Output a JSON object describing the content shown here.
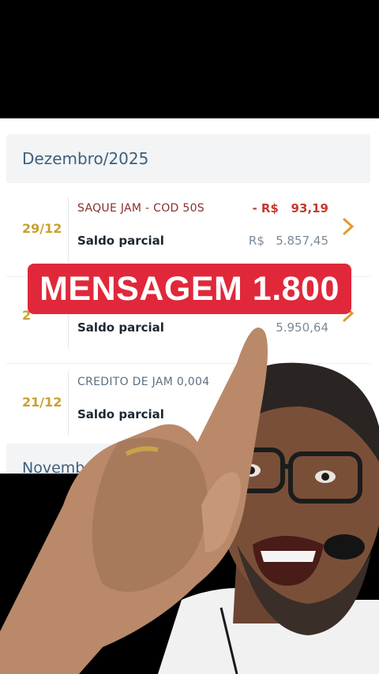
{
  "statement": {
    "month_current": "Dezembro/2025",
    "month_next": "Novemb",
    "saldo_label": "Saldo parcial",
    "entries": [
      {
        "date": "29/12",
        "description": "SAQUE JAM - COD 50S",
        "amount": "- R$   93,19",
        "saldo": "R$   5.857,45"
      },
      {
        "date": "2",
        "description": "",
        "amount": "",
        "saldo": "5.950,64"
      },
      {
        "date": "21/12",
        "description": "CREDITO DE JAM 0,004",
        "amount": "",
        "saldo": ""
      }
    ]
  },
  "overlay": {
    "banner_text": "MENSAGEM 1.800"
  },
  "colors": {
    "banner_red": "#e0283a",
    "date_gold": "#caa02e",
    "debit_red": "#c43a2c",
    "chevron_orange": "#e09a2a"
  },
  "icons": [
    "chevron-right-icon"
  ]
}
